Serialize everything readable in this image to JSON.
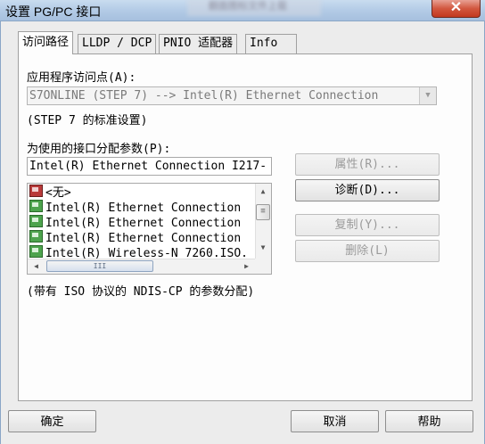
{
  "window": {
    "title": "设置 PG/PC 接口",
    "close_label": "✕",
    "background_hint": "翻面图标文件上载"
  },
  "tabs": [
    {
      "label": "访问路径",
      "active": true
    },
    {
      "label": "LLDP / DCP",
      "active": false
    },
    {
      "label": "PNIO 适配器",
      "active": false
    },
    {
      "label": "Info",
      "active": false
    }
  ],
  "access_point": {
    "label": "应用程序访问点(A):",
    "value": "S7ONLINE (STEP 7)      --> Intel(R) Ethernet Connection",
    "note": "(STEP 7 的标准设置)"
  },
  "params": {
    "label": "为使用的接口分配参数(P):",
    "value": "Intel(R) Ethernet Connection I217-"
  },
  "interface_list": [
    {
      "text": "<无>",
      "icon": "no-interface-icon"
    },
    {
      "text": "Intel(R) Ethernet Connection",
      "icon": "network-adapter-icon"
    },
    {
      "text": "Intel(R) Ethernet Connection",
      "icon": "network-adapter-icon"
    },
    {
      "text": "Intel(R) Ethernet Connection",
      "icon": "network-adapter-icon"
    },
    {
      "text": "Intel(R) Wireless-N 7260.ISO.",
      "icon": "network-adapter-icon"
    }
  ],
  "side_buttons": {
    "properties": "属性(R)...",
    "diagnostics": "诊断(D)...",
    "copy": "复制(Y)...",
    "delete": "删除(L)"
  },
  "footnote": "(带有 ISO 协议的 NDIS-CP 的参数分配)",
  "footer": {
    "ok": "确定",
    "cancel": "取消",
    "help": "帮助"
  }
}
